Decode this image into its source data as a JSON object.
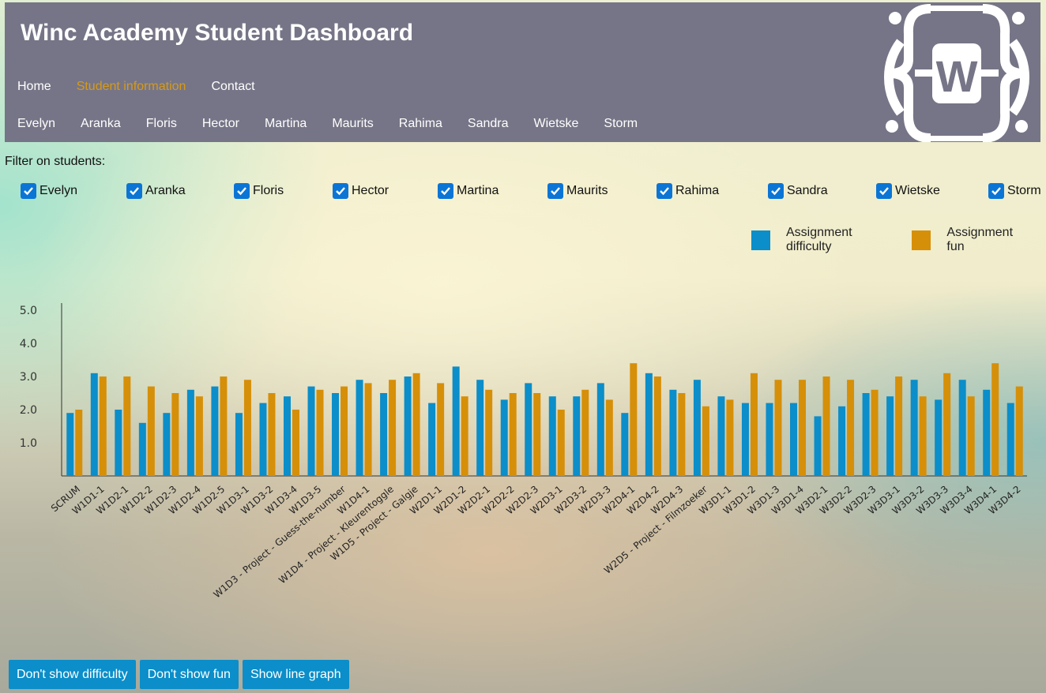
{
  "header": {
    "title": "Winc Academy Student Dashboard",
    "nav": [
      "Home",
      "Student information",
      "Contact"
    ],
    "nav_active": "Student information",
    "students": [
      "Evelyn",
      "Aranka",
      "Floris",
      "Hector",
      "Martina",
      "Maurits",
      "Rahima",
      "Sandra",
      "Wietske",
      "Storm"
    ],
    "logo": {
      "letter": "W",
      "icon": "winc-logo-icon"
    }
  },
  "filter": {
    "label": "Filter on students:",
    "students": [
      "Evelyn",
      "Aranka",
      "Floris",
      "Hector",
      "Martina",
      "Maurits",
      "Rahima",
      "Sandra",
      "Wietske",
      "Storm"
    ],
    "all_checked": true
  },
  "legend": {
    "difficulty": "Assignment difficulty",
    "fun": "Assignment fun"
  },
  "colors": {
    "header_bg": "#767587",
    "active_nav": "#d69a1a",
    "difficulty": "#0b8ec9",
    "fun": "#d68f08",
    "checkbox": "#0b75d6",
    "button": "#0b8ec9"
  },
  "chart_data": {
    "type": "bar",
    "categories": [
      "SCRUM",
      "W1D1-1",
      "W1D2-1",
      "W1D2-2",
      "W1D2-3",
      "W1D2-4",
      "W1D2-5",
      "W1D3-1",
      "W1D3-2",
      "W1D3-4",
      "W1D3-5",
      "W1D3 - Project - Guess-the-number",
      "W1D4-1",
      "W1D4 - Project - Kleurentoggle",
      "W1D5 - Project - Galgje",
      "W2D1-1",
      "W2D1-2",
      "W2D2-1",
      "W2D2-2",
      "W2D2-3",
      "W2D3-1",
      "W2D3-2",
      "W2D3-3",
      "W2D4-1",
      "W2D4-2",
      "W2D4-3",
      "W2D5 - Project - Filmzoeker",
      "W3D1-1",
      "W3D1-2",
      "W3D1-3",
      "W3D1-4",
      "W3D2-1",
      "W3D2-2",
      "W3D2-3",
      "W3D3-1",
      "W3D3-2",
      "W3D3-3",
      "W3D3-4",
      "W3D4-1",
      "W3D4-2"
    ],
    "series": [
      {
        "name": "Assignment difficulty",
        "values": [
          1.9,
          3.1,
          2.0,
          1.6,
          1.9,
          2.6,
          2.7,
          1.9,
          2.2,
          2.4,
          2.7,
          2.5,
          2.9,
          2.5,
          3.0,
          2.2,
          3.3,
          2.9,
          2.3,
          2.8,
          2.4,
          2.4,
          2.8,
          1.9,
          3.1,
          2.6,
          2.9,
          2.4,
          2.2,
          2.2,
          2.2,
          1.8,
          2.1,
          2.5,
          2.4,
          2.9,
          2.3,
          2.9,
          2.6,
          2.2
        ]
      },
      {
        "name": "Assignment fun",
        "values": [
          2.0,
          3.0,
          3.0,
          2.7,
          2.5,
          2.4,
          3.0,
          2.9,
          2.5,
          2.0,
          2.6,
          2.7,
          2.8,
          2.9,
          3.1,
          2.8,
          2.4,
          2.6,
          2.5,
          2.5,
          2.0,
          2.6,
          2.3,
          3.4,
          3.0,
          2.5,
          2.1,
          2.3,
          3.1,
          2.9,
          2.9,
          3.0,
          2.9,
          2.6,
          3.0,
          2.4,
          3.1,
          2.4,
          3.4,
          2.7
        ]
      }
    ],
    "y_ticks": [
      "1.0",
      "2.0",
      "3.0",
      "4.0",
      "5.0"
    ],
    "ylim": [
      0,
      5
    ],
    "grid": false,
    "legend_position": "top-right"
  },
  "buttons": {
    "difficulty": "Don't show difficulty",
    "fun": "Don't show fun",
    "line": "Show line graph"
  }
}
